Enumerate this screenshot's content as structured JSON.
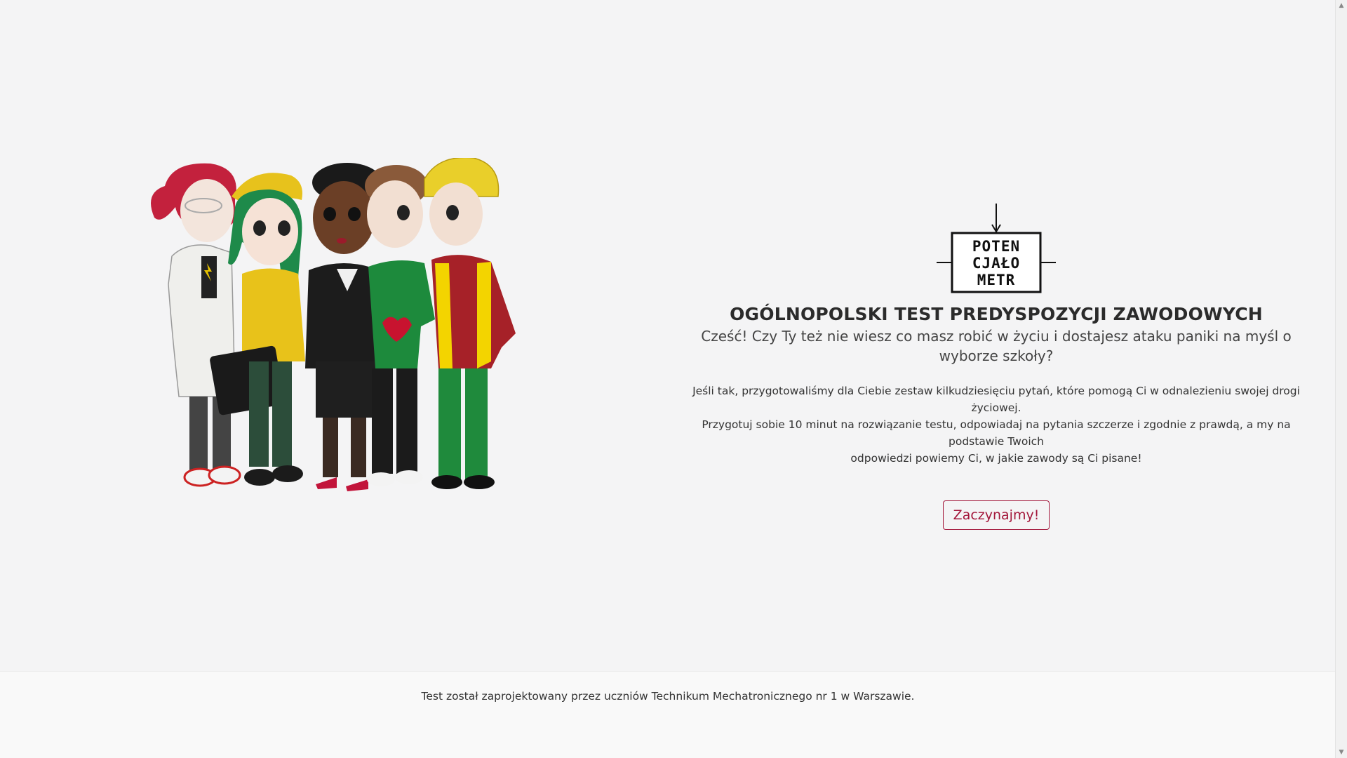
{
  "logo": {
    "lines": [
      "POTEN",
      "CJAŁO",
      "METR"
    ]
  },
  "hero": {
    "title": "OGÓLNOPOLSKI TEST PREDYSPOZYCJI ZAWODOWYCH",
    "subtitle": "Cześć! Czy Ty też nie wiesz co masz robić w życiu i dostajesz ataku paniki na myśl o wyborze szkoły?",
    "description_line1": "Jeśli tak, przygotowaliśmy dla Ciebie zestaw kilkudziesięciu pytań, które pomogą Ci w odnalezieniu swojej drogi życiowej.",
    "description_line2": "Przygotuj sobie 10 minut na rozwiązanie testu, odpowiadaj na pytania szczerze i zgodnie z prawdą, a my na podstawie Twoich",
    "description_line3": "odpowiedzi powiemy Ci, w jakie zawody są Ci pisane!",
    "start_button": "Zaczynajmy!"
  },
  "footer": {
    "text": "Test został zaprojektowany przez uczniów Technikum Mechatronicznego nr 1 w Warszawie."
  },
  "colors": {
    "accent": "#a3163a",
    "background": "#f4f4f5"
  },
  "icons": {
    "scroll_up": "scroll-up-arrow-icon",
    "scroll_down": "scroll-down-arrow-icon"
  }
}
